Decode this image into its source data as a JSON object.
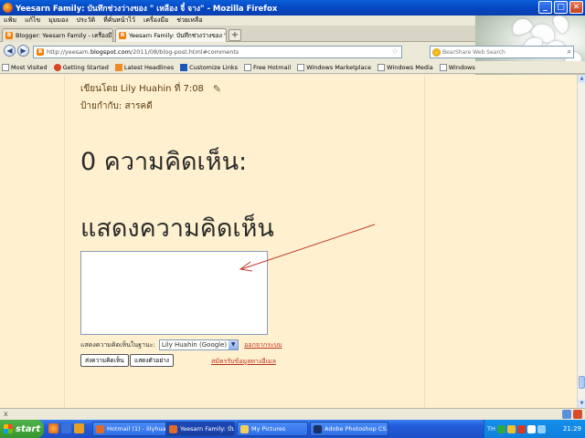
{
  "window": {
    "title": "Yeesarn Family: บันทึกช่วงว่างของ \" เหลือง จี๋ จาง\" - Mozilla Firefox",
    "minimize": "_",
    "maximize": "□",
    "close": "✕"
  },
  "menu": [
    "แฟ้ม",
    "แก้ไข",
    "มุมมอง",
    "ประวัติ",
    "ที่คั่นหน้าไว้",
    "เครื่องมือ",
    "ช่วยเหลือ"
  ],
  "tabs": [
    {
      "label": "Blogger: Yeesarn Family - เครื่องมือออกแ...",
      "close": "×",
      "active": false
    },
    {
      "label": "Yeesarn Family: บันทึกช่วงว่างของ \" เหลือง ...",
      "close": "×",
      "active": true
    }
  ],
  "new_tab": "+",
  "nav": {
    "back": "◀",
    "forward": "▶",
    "url_prefix": "http://yeesarn.",
    "url_host": "blogspot.com",
    "url_rest": "/2011/08/blog-post.html#comments",
    "search_placeholder": "BearShare Web Search"
  },
  "bookmarks": [
    "Most Visited",
    "Getting Started",
    "Latest Headlines",
    "Customize Links",
    "Free Hotmail",
    "Windows Marketplace",
    "Windows Media",
    "Windows"
  ],
  "post": {
    "byline": "เขียนโดย Lily Huahin ที่ 7:08",
    "labels_prefix": "ป้ายกำกับ:",
    "labels_value": "สารคดี",
    "comments_heading": "0 ความคิดเห็น:",
    "post_comment_heading": "แสดงความคิดเห็น",
    "comment_value": "",
    "identity_label": "แสดงความคิดเห็นในฐานะ:",
    "identity_selected": "Lily Huahin (Google)",
    "signout_label": "ออกจากระบบ",
    "publish_label": "ส่งความคิดเห็น",
    "preview_label": "แสดงตัวอย่าง",
    "subscribe_label": "สมัครรับข้อมูลทางอีเมล"
  },
  "statusbar": {
    "close": "x"
  },
  "taskbar": {
    "start": "start",
    "tasks": [
      {
        "label": "Hotmail (1) - lilyhuahi...",
        "active": false
      },
      {
        "label": "Yeesarn Family: บันที...",
        "active": true
      },
      {
        "label": "My Pictures",
        "active": false
      },
      {
        "label": "Adobe Photoshop CS...",
        "active": false
      }
    ],
    "lang": "TH",
    "clock": "21:29"
  },
  "colors": {
    "page_bg": "#fff1cf",
    "byline_text": "#5a3a14",
    "link_red": "#c0311c",
    "arrow_red": "#c0392b",
    "xp_blue": "#245edb",
    "start_green": "#36962f"
  }
}
